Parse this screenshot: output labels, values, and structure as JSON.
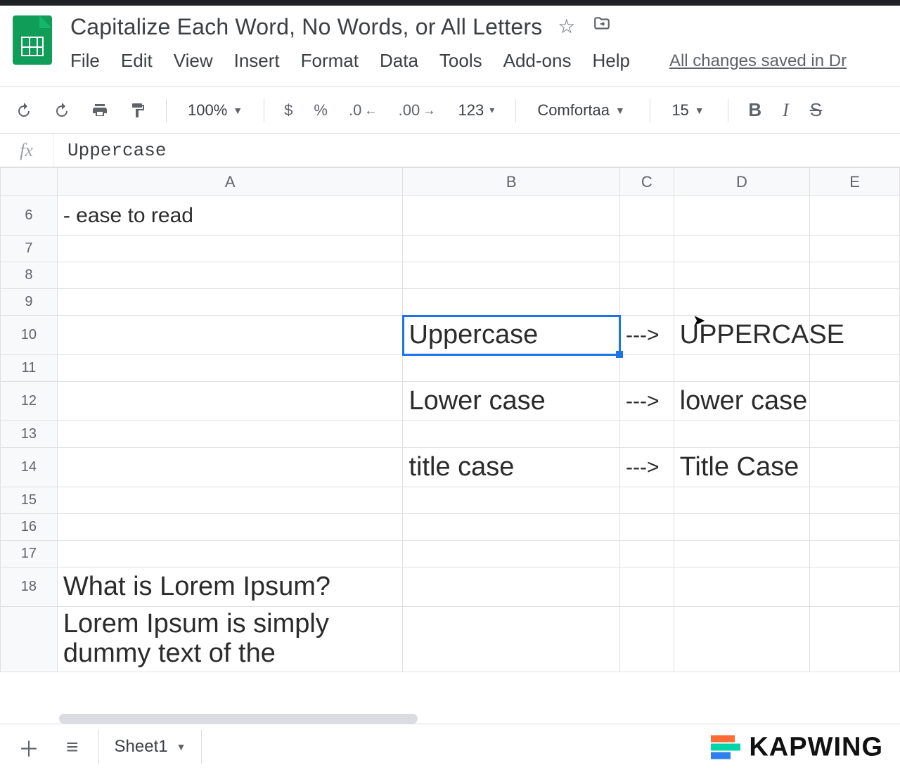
{
  "doc": {
    "title": "Capitalize Each Word, No Words, or All Letters",
    "status": "All changes saved in Dr"
  },
  "menus": {
    "file": "File",
    "edit": "Edit",
    "view": "View",
    "insert": "Insert",
    "format": "Format",
    "data": "Data",
    "tools": "Tools",
    "addons": "Add-ons",
    "help": "Help"
  },
  "toolbar": {
    "zoom": "100%",
    "currency": "$",
    "percent": "%",
    "decrease_decimal": ".0",
    "increase_decimal": ".00",
    "more_formats": "123",
    "font": "Comfortaa",
    "font_size": "15",
    "bold": "B",
    "italic": "I",
    "strike": "S"
  },
  "formula": {
    "fx_label": "fx",
    "value": "Uppercase"
  },
  "columns": {
    "corner": "",
    "A": "A",
    "B": "B",
    "C": "C",
    "D": "D",
    "E": "E"
  },
  "rows": {
    "r6": "6",
    "r7": "7",
    "r8": "8",
    "r9": "9",
    "r10": "10",
    "r11": "11",
    "r12": "12",
    "r13": "13",
    "r14": "14",
    "r15": "15",
    "r16": "16",
    "r17": "17",
    "r18": "18",
    "r19": ""
  },
  "cells": {
    "A6": "- ease to read",
    "B10": "Uppercase",
    "C10": "--->",
    "D10": "UPPERCASE",
    "B12": "Lower case",
    "C12": "--->",
    "D12": "lower case",
    "B14": "title case",
    "C14": "--->",
    "D14": "Title Case",
    "A18": "What is Lorem Ipsum?",
    "A19": "Lorem Ipsum is simply dummy text of the"
  },
  "bottom": {
    "sheet_name": "Sheet1",
    "brand": "KAPWING"
  }
}
